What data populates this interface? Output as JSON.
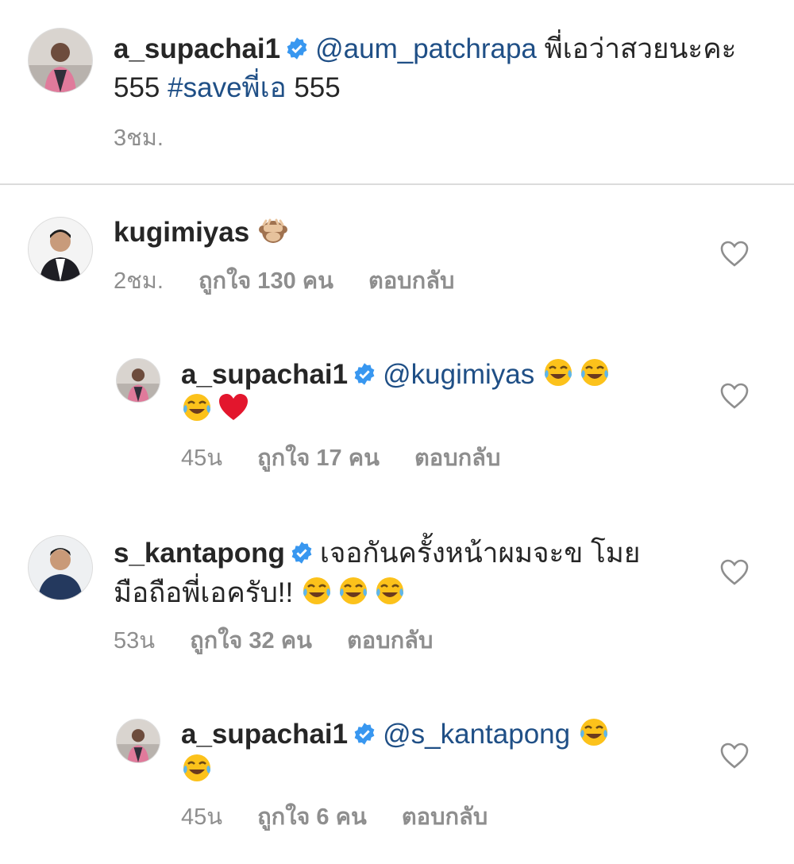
{
  "caption": {
    "username": "a_supachai1",
    "mention": "@aum_patchrapa",
    "text1": "พี่เอว่าสวยนะคะ",
    "text2_pre": "555",
    "hashtag": "#saveพี่เอ",
    "text2_post": "555",
    "time": "3ชม."
  },
  "comments": [
    {
      "username": "kugimiyas",
      "text": "",
      "emoji": [
        "see-no-evil-monkey"
      ],
      "time": "2ชม.",
      "likes": "ถูกใจ 130 คน",
      "reply": "ตอบกลับ"
    },
    {
      "username": "a_supachai1",
      "mention": "@kugimiyas",
      "emoji": [
        "face-with-tears-of-joy",
        "face-with-tears-of-joy",
        "face-with-tears-of-joy",
        "red-heart"
      ],
      "time": "45น",
      "likes": "ถูกใจ 17 คน",
      "reply": "ตอบกลับ"
    },
    {
      "username": "s_kantapong",
      "text1": "เจอกันครั้งหน้าผมจะข โมย",
      "text2": "มือถือพี่เอครับ!!",
      "emoji": [
        "face-with-tears-of-joy",
        "face-with-tears-of-joy",
        "face-with-tears-of-joy"
      ],
      "time": "53น",
      "likes": "ถูกใจ 32 คน",
      "reply": "ตอบกลับ"
    },
    {
      "username": "a_supachai1",
      "mention": "@s_kantapong",
      "emoji": [
        "face-with-tears-of-joy",
        "face-with-tears-of-joy"
      ],
      "time": "45น",
      "likes": "ถูกใจ 6 คน",
      "reply": "ตอบกลับ"
    }
  ],
  "colors": {
    "link": "#1f4f86",
    "muted": "#8e8e8e",
    "verified": "#3897f0",
    "heart": "#ed4956"
  }
}
